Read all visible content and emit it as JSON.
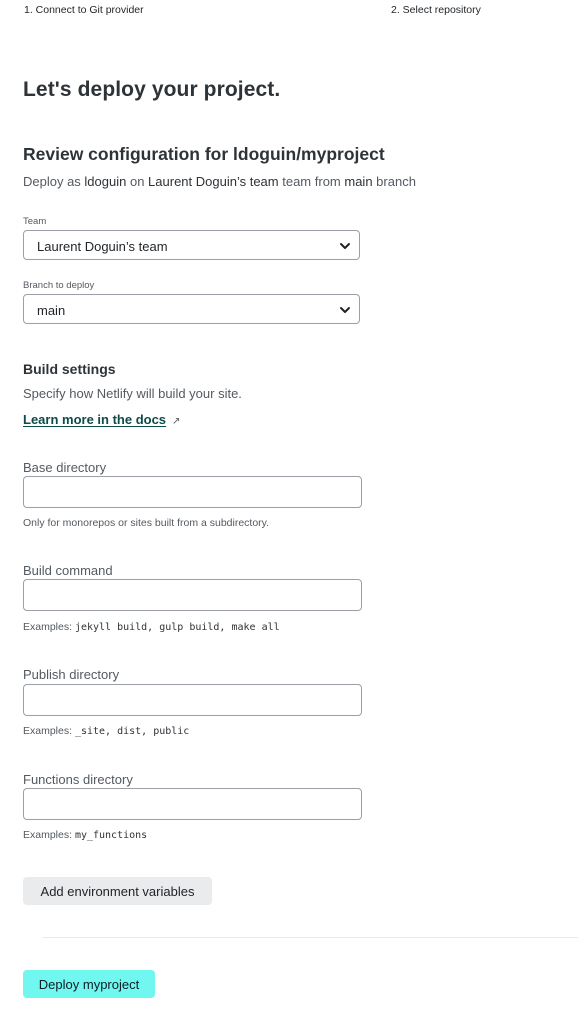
{
  "steps": {
    "step1": "1. Connect to Git provider",
    "step2": "2. Select repository"
  },
  "page_title": "Let's deploy your project.",
  "review": {
    "title": "Review configuration for ldoguin/myproject",
    "summary_prefix": "Deploy as ",
    "user": "ldoguin",
    "summary_on": " on ",
    "team": "Laurent Doguin’s team",
    "summary_team_word": " team from ",
    "branch": "main",
    "summary_suffix": " branch"
  },
  "team_field": {
    "label": "Team",
    "value": "Laurent Doguin’s team"
  },
  "branch_field": {
    "label": "Branch to deploy",
    "value": "main"
  },
  "build_settings": {
    "heading": "Build settings",
    "description": "Specify how Netlify will build your site.",
    "docs_link": "Learn more in the docs",
    "external_icon": "external-link-icon"
  },
  "base_directory": {
    "label": "Base directory",
    "value": "",
    "help": "Only for monorepos or sites built from a subdirectory."
  },
  "build_command": {
    "label": "Build command",
    "value": "",
    "help_prefix": "Examples: ",
    "help_code": "jekyll build, gulp build, make all"
  },
  "publish_directory": {
    "label": "Publish directory",
    "value": "",
    "help_prefix": "Examples: ",
    "help_code": "_site, dist, public"
  },
  "functions_directory": {
    "label": "Functions directory",
    "value": "",
    "help_prefix": "Examples: ",
    "help_code": "my_functions"
  },
  "buttons": {
    "env_vars": "Add environment variables",
    "deploy": "Deploy myproject"
  },
  "colors": {
    "deploy_button": "#6ff7f0",
    "secondary_button": "#e9ebed",
    "link": "#0d4a4a",
    "text": "#2e3338"
  }
}
